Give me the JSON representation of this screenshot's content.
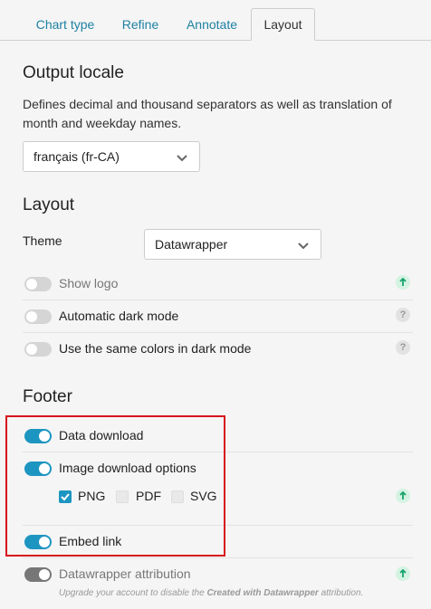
{
  "tabs": [
    {
      "label": "Chart type"
    },
    {
      "label": "Refine"
    },
    {
      "label": "Annotate"
    },
    {
      "label": "Layout"
    }
  ],
  "locale": {
    "heading": "Output locale",
    "description": "Defines decimal and thousand separators as well as translation of month and weekday names.",
    "selected": "français (fr-CA)"
  },
  "layout": {
    "heading": "Layout",
    "theme_label": "Theme",
    "theme_value": "Datawrapper",
    "show_logo": {
      "label": "Show logo",
      "enabled": false
    },
    "auto_dark": {
      "label": "Automatic dark mode",
      "enabled": false
    },
    "same_colors": {
      "label": "Use the same colors in dark mode",
      "enabled": false
    }
  },
  "footer": {
    "heading": "Footer",
    "data_download": {
      "label": "Data download",
      "enabled": true
    },
    "image_download": {
      "label": "Image download options",
      "enabled": true
    },
    "formats": [
      {
        "label": "PNG",
        "checked": true
      },
      {
        "label": "PDF",
        "checked": false
      },
      {
        "label": "SVG",
        "checked": false
      }
    ],
    "embed_link": {
      "label": "Embed link",
      "enabled": true
    },
    "attribution": {
      "label": "Datawrapper attribution",
      "enabled": true
    },
    "note_pre": "Upgrade your account to disable the ",
    "note_bold": "Created with Datawrapper",
    "note_post": " attribution."
  },
  "icons": {
    "help": "?",
    "upgrade_color": "#1aa36b",
    "accent": "#1d95c1",
    "highlight": "#d7141e"
  }
}
